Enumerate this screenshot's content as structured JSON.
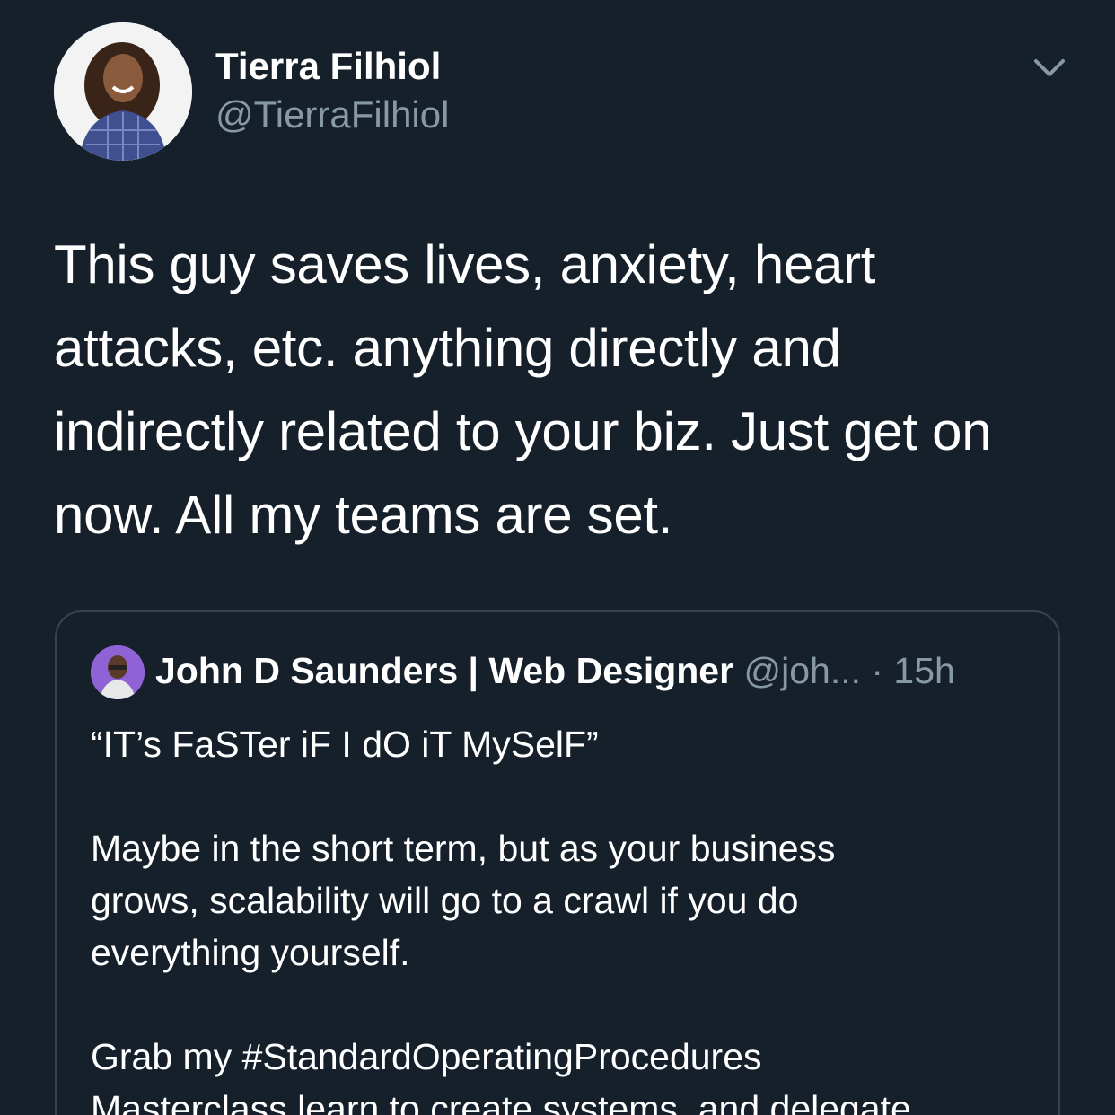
{
  "tweet": {
    "author_name": "Tierra Filhiol",
    "author_handle": "@TierraFilhiol",
    "text_lines": [
      "This guy saves lives, anxiety, heart",
      "attacks, etc. anything directly and",
      "indirectly related to your biz. Just get on",
      "now. All my teams are set."
    ]
  },
  "quoted_tweet": {
    "author_name": "John D Saunders | Web Designer",
    "handle_time": "@joh... · 15h",
    "body_lines": [
      "“IT’s FaSTer iF I dO iT MySelF”",
      "",
      "Maybe in the short term, but as your business",
      "grows, scalability will go to a crawl if you do",
      "everything yourself.",
      "",
      "Grab my #StandardOperatingProcedures",
      "Masterclass learn to create systems, and delegate"
    ]
  },
  "icons": {
    "caret": "chevron-down-icon"
  },
  "colors": {
    "background": "#15202b",
    "secondary_text": "#8899a6",
    "border": "#38444d"
  }
}
